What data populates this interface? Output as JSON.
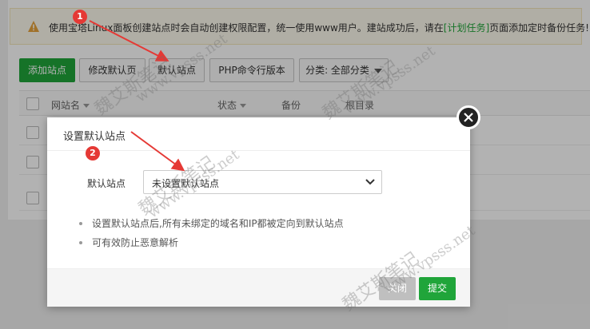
{
  "notice": {
    "text_before": "使用宝塔Linux面板创建站点时会自动创建权限配置，统一使用www用户。建站成功后，请在",
    "link": "[计划任务]",
    "text_after": "页面添加定时备份任务!",
    "icon": "warning-icon"
  },
  "toolbar": {
    "add_site": "添加站点",
    "modify_default_page": "修改默认页",
    "default_site": "默认站点",
    "php_cli_version": "PHP命令行版本",
    "category": "分类: 全部分类"
  },
  "table": {
    "headers": [
      "网站名",
      "状态",
      "备份",
      "根目录"
    ]
  },
  "modal": {
    "title": "设置默认站点",
    "label": "默认站点",
    "select_value": "未设置默认站点",
    "tips": [
      "设置默认站点后,所有未绑定的域名和IP都被定向到默认站点",
      "可有效防止恶意解析"
    ],
    "close": "关闭",
    "submit": "提交"
  },
  "annotations": {
    "step1": "1",
    "step2": "2",
    "color": "#e53935"
  },
  "watermark": {
    "cn": "魏艾斯笔记",
    "url": "www.vpsss.net"
  },
  "colors": {
    "accent": "#20a53a",
    "overlay": "rgba(0,0,0,0.30)"
  }
}
